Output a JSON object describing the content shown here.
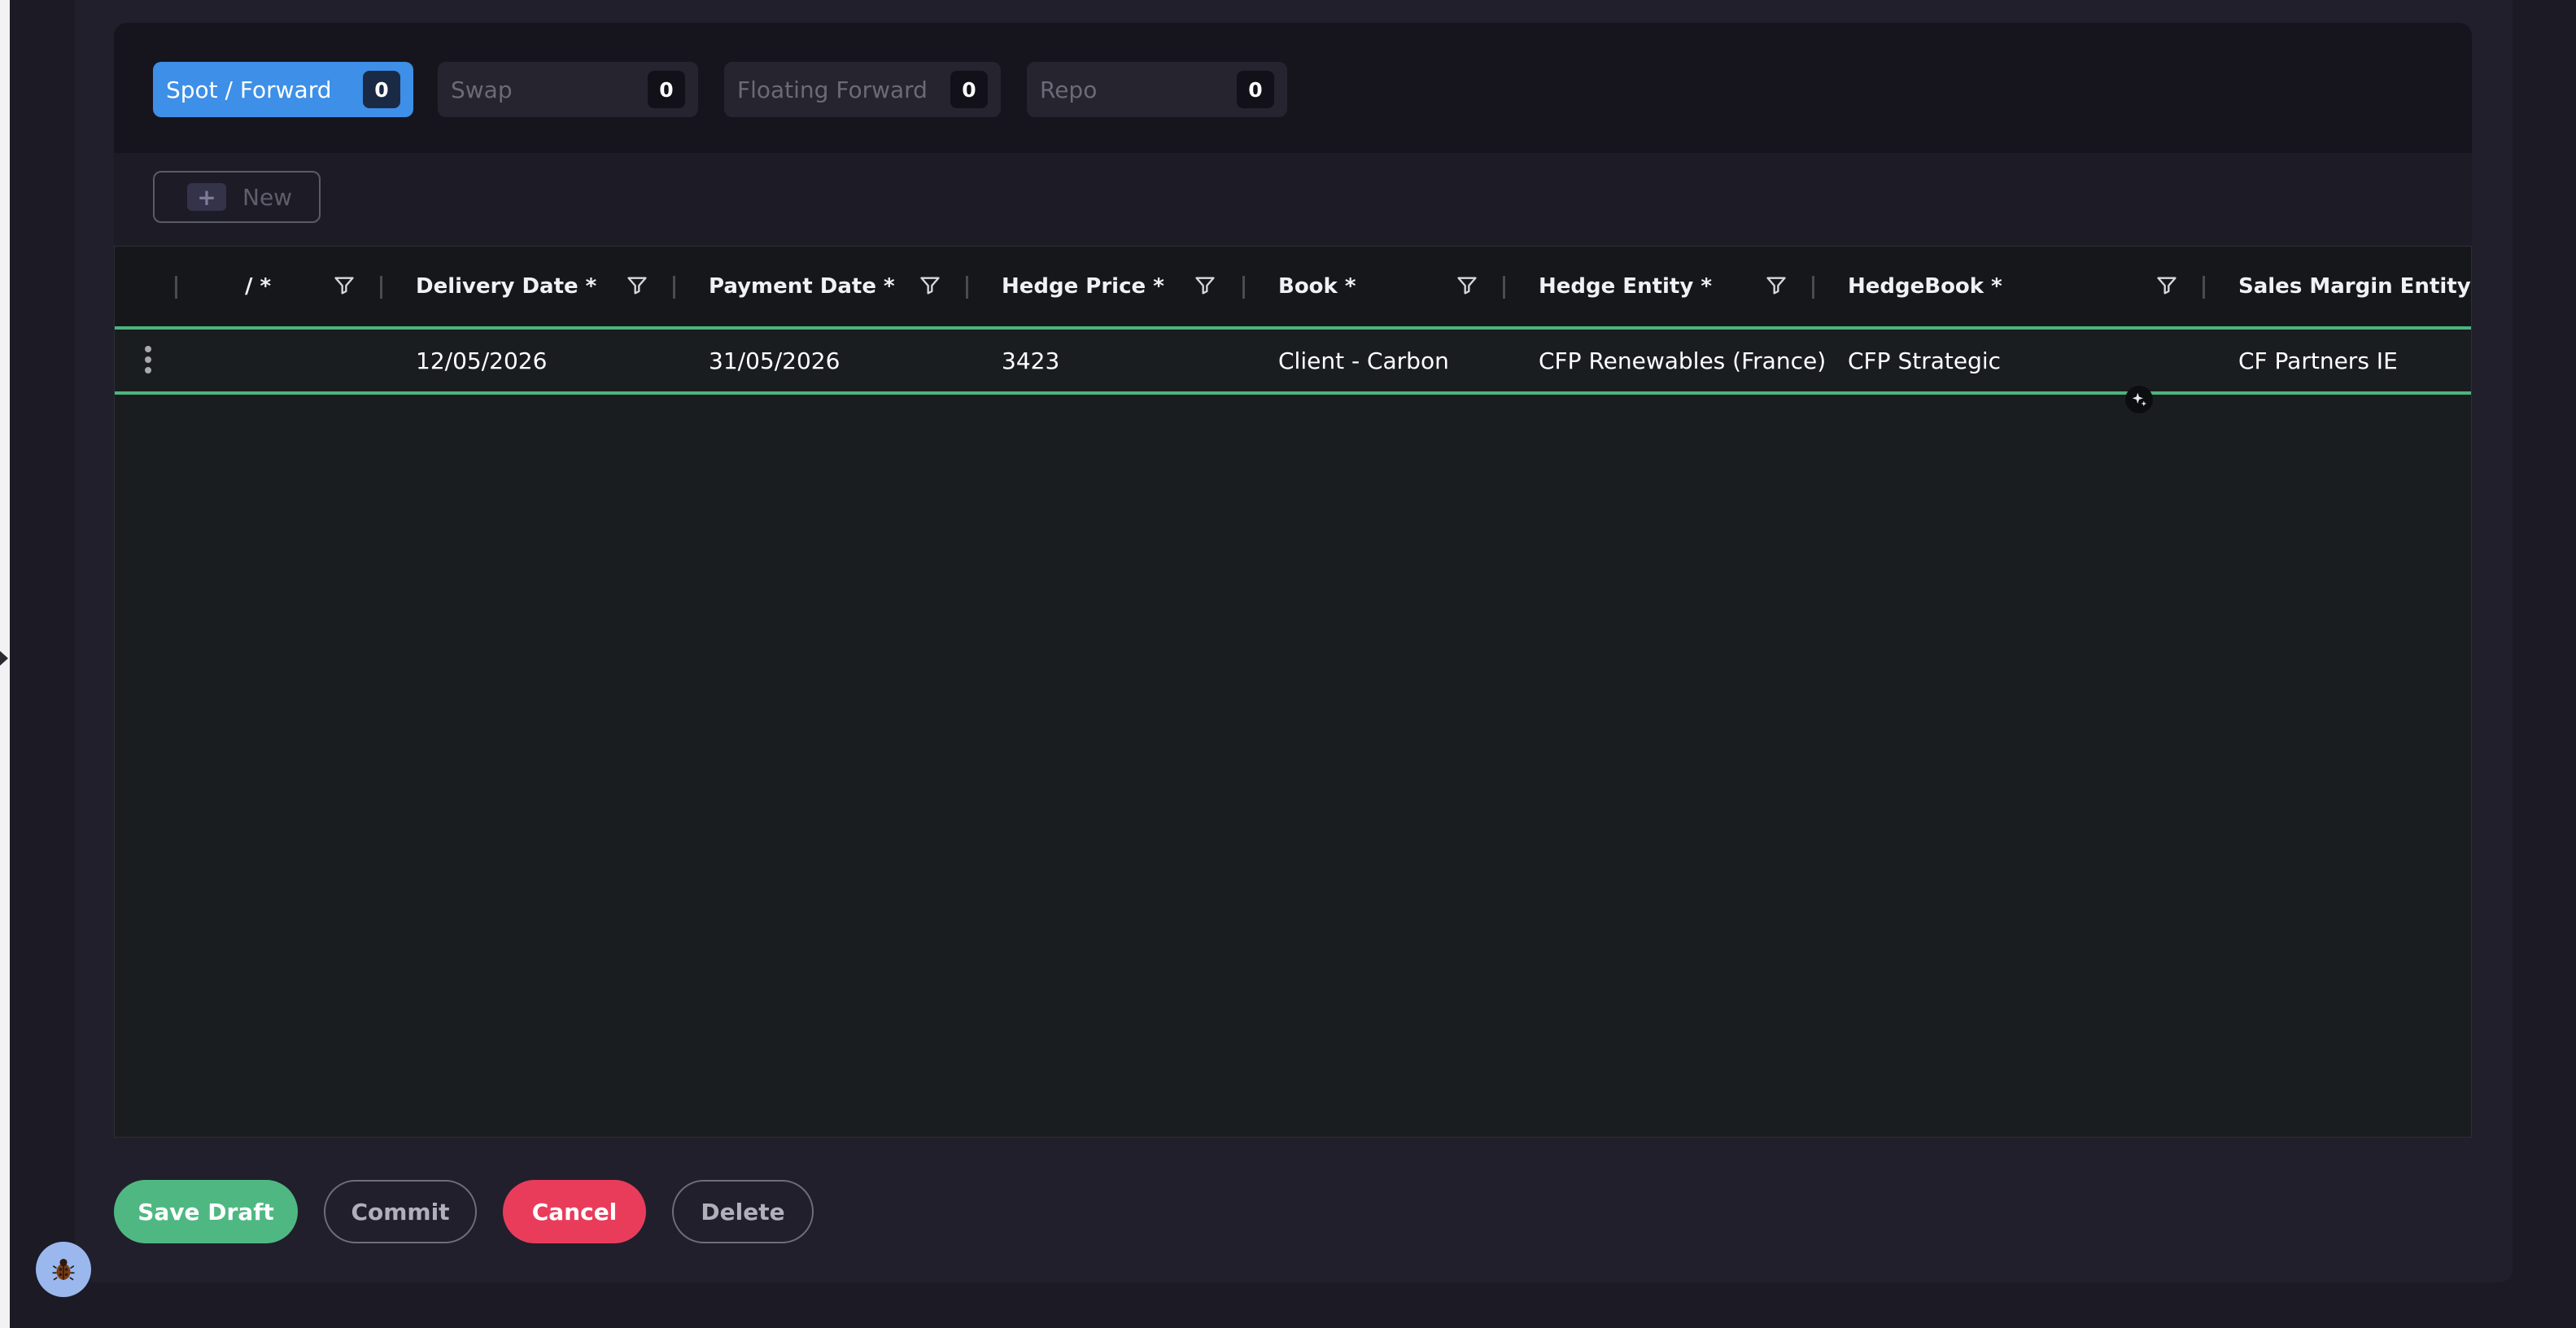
{
  "tabs": [
    {
      "label": "Spot / Forward",
      "count": "0",
      "active": true
    },
    {
      "label": "Swap",
      "count": "0",
      "active": false
    },
    {
      "label": "Floating Forward",
      "count": "0",
      "active": false
    },
    {
      "label": "Repo",
      "count": "0",
      "active": false
    }
  ],
  "toolbar": {
    "new_label": "New",
    "plus_glyph": "+"
  },
  "grid": {
    "columns": [
      {
        "label": "/ *"
      },
      {
        "label": "Delivery Date *"
      },
      {
        "label": "Payment Date *"
      },
      {
        "label": "Hedge Price *"
      },
      {
        "label": "Book *"
      },
      {
        "label": "Hedge Entity *"
      },
      {
        "label": "HedgeBook *"
      },
      {
        "label": "Sales Margin Entity *"
      }
    ],
    "rows": [
      {
        "delivery_date": "12/05/2026",
        "payment_date": "31/05/2026",
        "hedge_price": "3423",
        "book": "Client - Carbon",
        "hedge_entity": "CFP Renewables (France)",
        "hedgebook": "CFP Strategic",
        "sales_margin_entity": "CF Partners IE"
      }
    ]
  },
  "actions": {
    "save_draft": "Save Draft",
    "commit": "Commit",
    "cancel": "Cancel",
    "delete": "Delete"
  },
  "colors": {
    "accent_blue": "#3d8fe8",
    "save_green": "#4fb882",
    "cancel_red": "#e93c5b",
    "row_highlight": "#4cb47e"
  },
  "icons": [
    "filter-icon",
    "kebab-menu-icon",
    "plus-icon",
    "sparkle-icon",
    "bug-icon"
  ]
}
